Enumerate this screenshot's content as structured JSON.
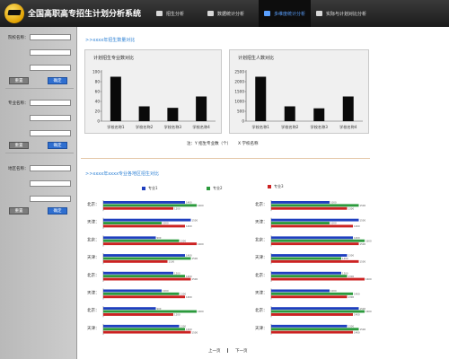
{
  "header": {
    "title": "全国高职高专招生计划分析系统",
    "nav": [
      {
        "label": "招生分析",
        "icon": "star-icon"
      },
      {
        "label": "数据统计分析",
        "icon": "chart-icon"
      },
      {
        "label": "多维度统计分析",
        "icon": "cube-icon",
        "active": true
      },
      {
        "label": "实际与计划对比分析",
        "icon": "compare-icon"
      }
    ]
  },
  "sidebar": {
    "groups": [
      {
        "label": "院校名称：",
        "reset": "重置",
        "ok": "确定"
      },
      {
        "label": "专业名称：",
        "reset": "重置",
        "ok": "确定"
      },
      {
        "label": "地区名称：",
        "reset": "重置",
        "ok": "确定"
      }
    ]
  },
  "main": {
    "section1_title": ">>xxxx年招生数量对比",
    "section2_title": ">>xxxx年xxxx专业各地区招生对比",
    "note": "注：Y 招生专业数（个）",
    "note2": "X 学校名称",
    "pager": {
      "prev": "上一页",
      "next": "下一页"
    }
  },
  "colors": {
    "blue": "#1f3fbf",
    "green": "#2b9a3c",
    "red": "#cc2222",
    "accent": "#2a7fd4"
  },
  "chart_data": [
    {
      "type": "bar",
      "title": "计划招生专业数对比",
      "categories": [
        "学校名称1",
        "学校名称2",
        "学校名称3",
        "学校名称4"
      ],
      "values": [
        90,
        30,
        27,
        50
      ],
      "yticks": [
        0,
        20,
        40,
        60,
        80,
        100
      ],
      "ylim": [
        0,
        100
      ]
    },
    {
      "type": "bar",
      "title": "计划招生人数对比",
      "categories": [
        "学校名称1",
        "学校名称2",
        "学校名称3",
        "学校名称4"
      ],
      "values": [
        2250,
        750,
        650,
        1250
      ],
      "yticks": [
        0,
        500,
        1000,
        1500,
        2000,
        2500
      ],
      "ylim": [
        0,
        2500
      ]
    },
    {
      "type": "bar",
      "orientation": "horizontal",
      "series": [
        {
          "name": "专业1",
          "color": "#1f3fbf"
        },
        {
          "name": "专业2",
          "color": "#2b9a3c"
        },
        {
          "name": "专业3",
          "color": "#cc2222"
        }
      ],
      "groups": [
        {
          "label": "北京：",
          "values": [
            1400,
            1600,
            1200
          ]
        },
        {
          "label": "天津：",
          "values": [
            1500,
            1000,
            1400
          ]
        },
        {
          "label": "北京：",
          "values": [
            900,
            1300,
            1600
          ]
        },
        {
          "label": "天津：",
          "values": [
            1400,
            1500,
            1100
          ]
        },
        {
          "label": "北京：",
          "values": [
            1200,
            1400,
            1500
          ]
        },
        {
          "label": "天津：",
          "values": [
            1000,
            1300,
            1400
          ]
        },
        {
          "label": "北京：",
          "values": [
            900,
            1600,
            1200
          ]
        },
        {
          "label": "天津：",
          "values": [
            1300,
            1400,
            1500
          ]
        }
      ]
    },
    {
      "type": "bar",
      "orientation": "horizontal",
      "series": [
        {
          "name": "专业1",
          "color": "#1f3fbf"
        },
        {
          "name": "专业2",
          "color": "#2b9a3c"
        },
        {
          "name": "专业3",
          "color": "#cc2222"
        }
      ],
      "groups": [
        {
          "label": "北京：",
          "values": [
            1000,
            1500,
            1300
          ]
        },
        {
          "label": "天津：",
          "values": [
            1500,
            1000,
            1400
          ]
        },
        {
          "label": "北京：",
          "values": [
            1400,
            1600,
            1500
          ]
        },
        {
          "label": "天津：",
          "values": [
            1300,
            1200,
            1500
          ]
        },
        {
          "label": "北京：",
          "values": [
            1200,
            1300,
            1600
          ]
        },
        {
          "label": "天津：",
          "values": [
            1000,
            1400,
            1300
          ]
        },
        {
          "label": "北京：",
          "values": [
            1500,
            1600,
            1400
          ]
        },
        {
          "label": "天津：",
          "values": [
            1300,
            1500,
            1400
          ]
        }
      ]
    }
  ]
}
